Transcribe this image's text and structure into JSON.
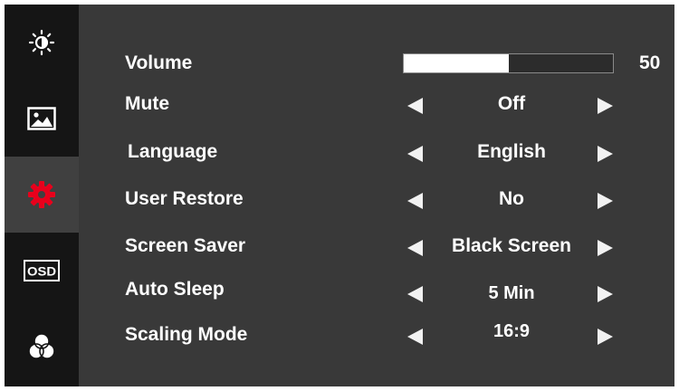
{
  "sidebar": {
    "items": [
      {
        "icon": "brightness-icon",
        "active": false
      },
      {
        "icon": "picture-icon",
        "active": false
      },
      {
        "icon": "gear-icon",
        "active": true,
        "color": "#e8001c"
      },
      {
        "icon": "osd-icon",
        "label": "OSD",
        "active": false
      },
      {
        "icon": "color-icon",
        "active": false
      }
    ]
  },
  "settings": {
    "volume": {
      "label": "Volume",
      "value": "50",
      "level": 0.5
    },
    "mute": {
      "label": "Mute",
      "value": "Off"
    },
    "language": {
      "label": "Language",
      "value": "English"
    },
    "user_restore": {
      "label": "User Restore",
      "value": "No"
    },
    "screen_saver": {
      "label": "Screen Saver",
      "value": "Black Screen"
    },
    "auto_sleep": {
      "label": "Auto Sleep",
      "value": "5 Min"
    },
    "scaling_mode": {
      "label": "Scaling Mode",
      "value": "16:9"
    }
  }
}
